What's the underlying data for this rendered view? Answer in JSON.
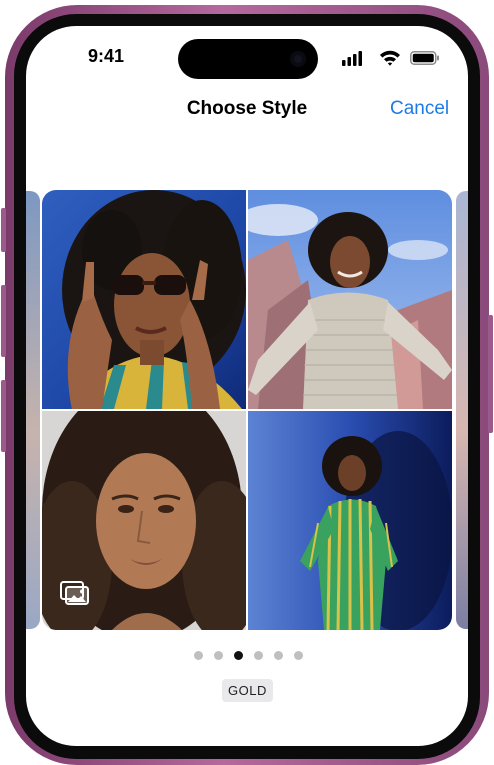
{
  "status_bar": {
    "time": "9:41"
  },
  "header": {
    "title": "Choose Style",
    "cancel_label": "Cancel"
  },
  "photo_grid": {
    "tiles": [
      {
        "name": "photo-sunglasses"
      },
      {
        "name": "photo-striped-top"
      },
      {
        "name": "photo-portrait"
      },
      {
        "name": "photo-green-dress"
      }
    ],
    "library_icon": "photo-library-icon"
  },
  "page_indicator": {
    "pages": 6,
    "current": 3
  },
  "style_label": "GOLD",
  "colors": {
    "accent": "#1f7ae6",
    "frame": "#a55a92",
    "active_dot": "#111111"
  }
}
